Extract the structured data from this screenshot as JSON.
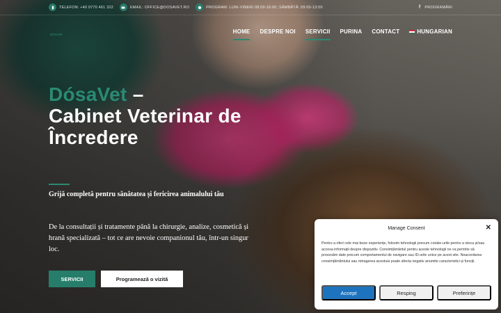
{
  "topbar": {
    "phone": "TELEFON: +40 0770 461 322",
    "email": "EMAIL: OFFICE@DOSAVET.RO",
    "schedule": "PROGRAM: LUNI-VINERI 08:00-16:00; SÂMBĂTĂ: 09:00-13:00",
    "facebook": "f",
    "appointments": "PROGRAMĂRI"
  },
  "header": {
    "logo_text": "DósaVet",
    "nav": [
      {
        "label": "HOME",
        "active": true
      },
      {
        "label": "DESPRE NOI",
        "active": false
      },
      {
        "label": "SERVICII",
        "active": true
      },
      {
        "label": "PURINA",
        "active": false
      },
      {
        "label": "CONTACT",
        "active": false
      },
      {
        "label": "HUNGARIAN",
        "active": false
      }
    ]
  },
  "hero": {
    "brand": "DósaVet",
    "title_dash": " –",
    "title_rest": "Cabinet Veterinar de Încredere",
    "subtitle": "Grijă completă pentru sănătatea și fericirea animalului tău",
    "description": "De la consultații și tratamente până la chirurgie, analize, cosmetică și hrană specializată – tot ce are nevoie companionul tău, într-un singur loc.",
    "btn_services": "SERVICII",
    "btn_schedule": "Programează o vizită"
  },
  "consent": {
    "title": "Manage Consent",
    "text": "Pentru a oferi cele mai bune experiențe, folosim tehnologii precum cookie-urile pentru a stoca și/sau accesa informații despre dispozitiv. Consimțământul pentru aceste tehnologii ne va permite să procesăm date precum comportamentul de navigare sau ID-urile unice pe acest site. Neacordarea consimțământului sau retragerea acestuia poate afecta negativ anumite caracteristici și funcții.",
    "accept": "Accept",
    "reject": "Resping",
    "preferences": "Preferințe"
  },
  "colors": {
    "brand_green": "#2a8a74",
    "accept_blue": "#1e73be"
  }
}
